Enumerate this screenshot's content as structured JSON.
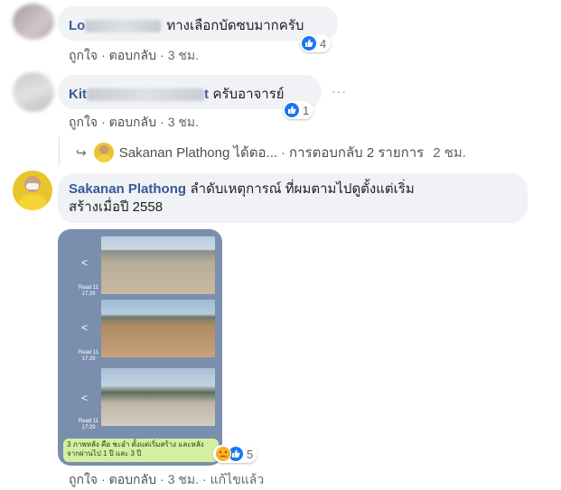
{
  "comments": [
    {
      "name_visible": "Lo",
      "text": "ทางเลือกบัดซบมากครับ",
      "reaction_count": "4",
      "actions": {
        "like": "ถูกใจ",
        "reply": "ตอบกลับ",
        "time": "3 ชม."
      }
    },
    {
      "name_visible_start": "Kit",
      "name_visible_end": "t",
      "text": "ครับอาจารย์",
      "reaction_count": "1",
      "more": "···",
      "actions": {
        "like": "ถูกใจ",
        "reply": "ตอบกลับ",
        "time": "3 ชม."
      },
      "reply_summary": {
        "arrow": "↪",
        "author": "Sakanan Plathong ได้ตอ...",
        "replies": "การตอบกลับ 2 รายการ",
        "time": "2 ชม."
      }
    },
    {
      "name": "Sakanan Plathong",
      "text_line1": "ลำดับเหตุการณ์ ที่ผมตามไปดูตั้งแต่เริ่ม",
      "text_line2": "สร้างเมื่อปี 2558",
      "reaction_count": "5",
      "attachment": {
        "stamps": [
          "Read 11\n17:29",
          "Read 11\n17:29",
          "Read 11\n17:29"
        ],
        "caption": "3 ภาพหลัง คือ ชะอำ ตั้งแต่เริ่มสร้าง และหลัง จากผ่านไป 1 ปี และ 3 ปี"
      },
      "actions": {
        "like": "ถูกใจ",
        "reply": "ตอบกลับ",
        "time": "3 ชม.",
        "edited": "แก้ไขแล้ว"
      }
    }
  ],
  "colors": {
    "name": "#385898",
    "like_blue": "#1877f2",
    "bubble": "#f0f2f5"
  }
}
